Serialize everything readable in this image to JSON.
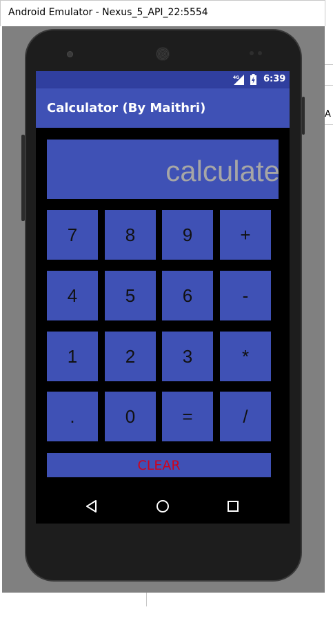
{
  "window": {
    "title": "Android Emulator - Nexus_5_API_22:5554",
    "edge_letter": "A"
  },
  "status_bar": {
    "time": "6:39",
    "network": "4G"
  },
  "app_bar": {
    "title": "Calculator (By Maithri)"
  },
  "display": {
    "placeholder": "calculate"
  },
  "keypad": {
    "rows": [
      [
        "7",
        "8",
        "9",
        "+"
      ],
      [
        "4",
        "5",
        "6",
        "-"
      ],
      [
        "1",
        "2",
        "3",
        "*"
      ],
      [
        ".",
        "0",
        "=",
        "/"
      ]
    ]
  },
  "clear_button": {
    "label": "CLEAR"
  },
  "nav_bar": {
    "buttons": [
      "back-icon",
      "home-icon",
      "recents-icon"
    ]
  },
  "colors": {
    "primary": "#3f51b5",
    "primary_dark": "#303f9f",
    "clear_text": "#d0021b",
    "placeholder_text": "#a6a6a6"
  }
}
